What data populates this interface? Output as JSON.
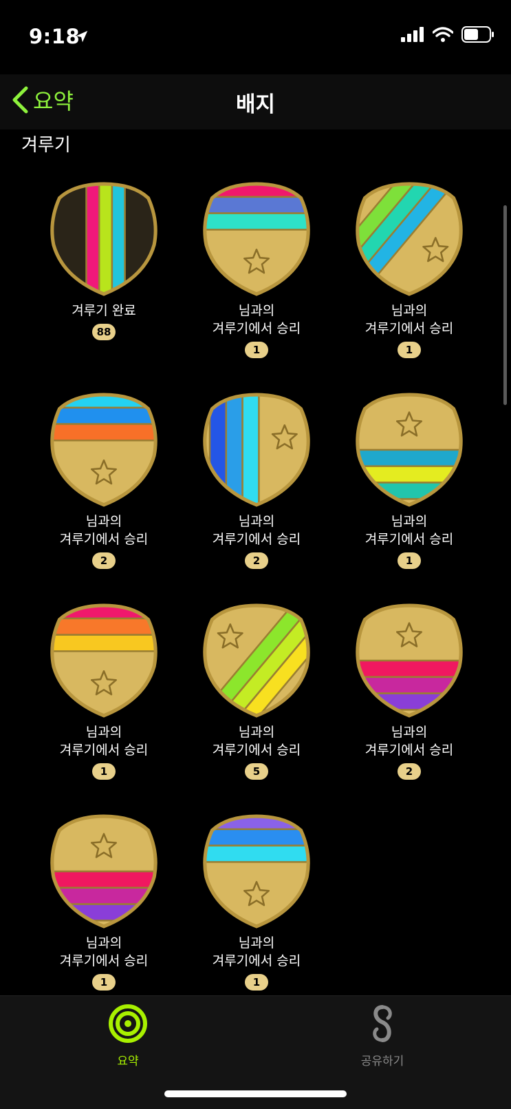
{
  "status": {
    "time": "9:18"
  },
  "nav": {
    "back_label": "요약",
    "title": "배지"
  },
  "section": {
    "title": "겨루기"
  },
  "badges": [
    {
      "name": "겨루기 완료",
      "count": "88",
      "colors": [
        "#f0187a",
        "#b8e41c",
        "#22c5dc"
      ],
      "style": "vertical-dark"
    },
    {
      "name": "님과의\n겨루기에서 승리",
      "count": "1",
      "colors": [
        "#f0186c",
        "#5a78d4",
        "#2ee2c8"
      ],
      "style": "horizontal-top"
    },
    {
      "name": "님과의\n겨루기에서 승리",
      "count": "1",
      "colors": [
        "#7ee03a",
        "#22d6b0",
        "#22b4e4"
      ],
      "style": "diagonal-left"
    },
    {
      "name": "님과의\n겨루기에서 승리",
      "count": "2",
      "colors": [
        "#24d2f2",
        "#2090ee",
        "#f87028"
      ],
      "style": "horizontal-top"
    },
    {
      "name": "님과의\n겨루기에서 승리",
      "count": "2",
      "colors": [
        "#2456e6",
        "#2a9ee8",
        "#30dcf0"
      ],
      "style": "vertical-left"
    },
    {
      "name": "님과의\n겨루기에서 승리",
      "count": "1",
      "colors": [
        "#1fa8cc",
        "#e4ec20",
        "#22c5ac"
      ],
      "style": "horizontal-bottom"
    },
    {
      "name": "님과의\n겨루기에서 승리",
      "count": "1",
      "colors": [
        "#f0186c",
        "#f8782a",
        "#f8c820"
      ],
      "style": "horizontal-top"
    },
    {
      "name": "님과의\n겨루기에서 승리",
      "count": "5",
      "colors": [
        "#8ce62c",
        "#c4ec24",
        "#f8e020"
      ],
      "style": "diagonal-right"
    },
    {
      "name": "님과의\n겨루기에서 승리",
      "count": "2",
      "colors": [
        "#f01860",
        "#c8289e",
        "#8a3ed8"
      ],
      "style": "horizontal-bottom"
    },
    {
      "name": "님과의\n겨루기에서 승리",
      "count": "1",
      "colors": [
        "#f01860",
        "#c8289e",
        "#8a3ed8"
      ],
      "style": "horizontal-bottom"
    },
    {
      "name": "님과의\n겨루기에서 승리",
      "count": "1",
      "colors": [
        "#8a62e8",
        "#2a8ef0",
        "#30dcf0"
      ],
      "style": "horizontal-top"
    }
  ],
  "tabs": [
    {
      "label": "요약",
      "icon": "activity-rings-icon",
      "active": true,
      "color": "#a8f000"
    },
    {
      "label": "공유하기",
      "icon": "sharing-icon",
      "active": false,
      "color": "#8a8a8a"
    }
  ],
  "colors": {
    "accent": "#8ef23c",
    "badge_gold": "#d8b860",
    "count_pill": "#e8d08a"
  }
}
